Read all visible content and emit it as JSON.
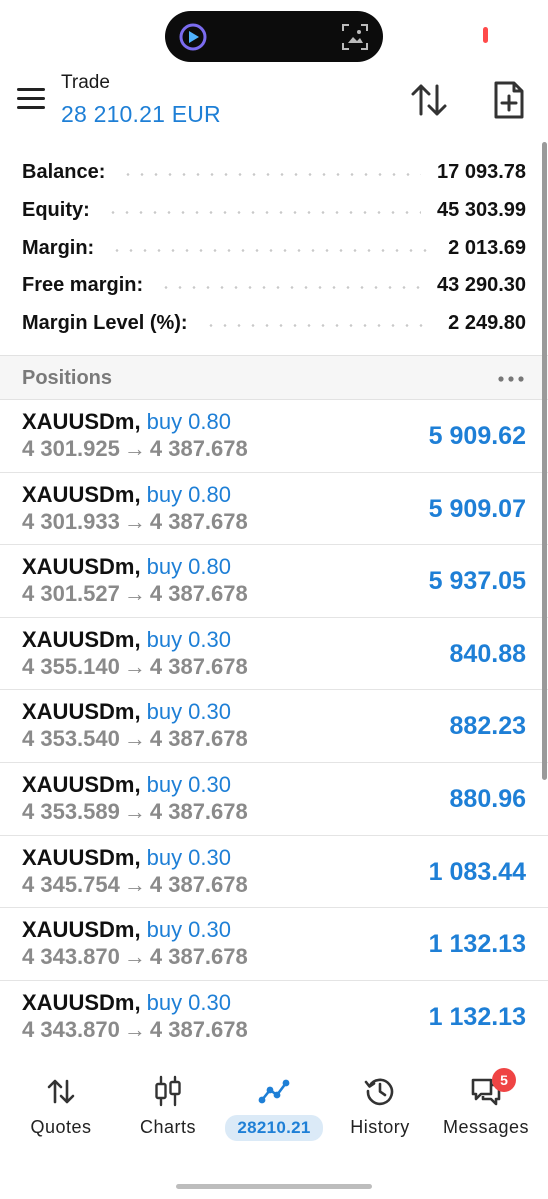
{
  "header": {
    "title": "Trade",
    "balance_text": "28 210.21 EUR"
  },
  "summary": [
    {
      "label": "Balance:",
      "value": "17 093.78"
    },
    {
      "label": "Equity:",
      "value": "45 303.99"
    },
    {
      "label": "Margin:",
      "value": "2 013.69"
    },
    {
      "label": "Free margin:",
      "value": "43 290.30"
    },
    {
      "label": "Margin Level (%):",
      "value": "2 249.80"
    }
  ],
  "positions_section": {
    "title": "Positions"
  },
  "positions": [
    {
      "symbol": "XAUUSDm",
      "type": "buy 0.80",
      "open": "4 301.925",
      "current": "4 387.678",
      "profit": "5 909.62"
    },
    {
      "symbol": "XAUUSDm",
      "type": "buy 0.80",
      "open": "4 301.933",
      "current": "4 387.678",
      "profit": "5 909.07"
    },
    {
      "symbol": "XAUUSDm",
      "type": "buy 0.80",
      "open": "4 301.527",
      "current": "4 387.678",
      "profit": "5 937.05"
    },
    {
      "symbol": "XAUUSDm",
      "type": "buy 0.30",
      "open": "4 355.140",
      "current": "4 387.678",
      "profit": "840.88"
    },
    {
      "symbol": "XAUUSDm",
      "type": "buy 0.30",
      "open": "4 353.540",
      "current": "4 387.678",
      "profit": "882.23"
    },
    {
      "symbol": "XAUUSDm",
      "type": "buy 0.30",
      "open": "4 353.589",
      "current": "4 387.678",
      "profit": "880.96"
    },
    {
      "symbol": "XAUUSDm",
      "type": "buy 0.30",
      "open": "4 345.754",
      "current": "4 387.678",
      "profit": "1 083.44"
    },
    {
      "symbol": "XAUUSDm",
      "type": "buy 0.30",
      "open": "4 343.870",
      "current": "4 387.678",
      "profit": "1 132.13"
    },
    {
      "symbol": "XAUUSDm",
      "type": "buy 0.30",
      "open": "4 343.870",
      "current": "4 387.678",
      "profit": "1 132.13"
    }
  ],
  "bottom_nav": {
    "quotes": "Quotes",
    "charts": "Charts",
    "trade_active": "28210.21",
    "history": "History",
    "messages": "Messages",
    "messages_badge": "5"
  },
  "colors": {
    "accent": "#1e7fd6",
    "badge": "#ef4444",
    "muted_text": "#8a8a8a"
  },
  "icons": [
    "app-logo-icon",
    "scan-icon",
    "menu-icon",
    "sort-icon",
    "new-order-icon",
    "more-icon",
    "quotes-icon",
    "charts-icon",
    "trade-icon",
    "history-icon",
    "messages-icon"
  ]
}
